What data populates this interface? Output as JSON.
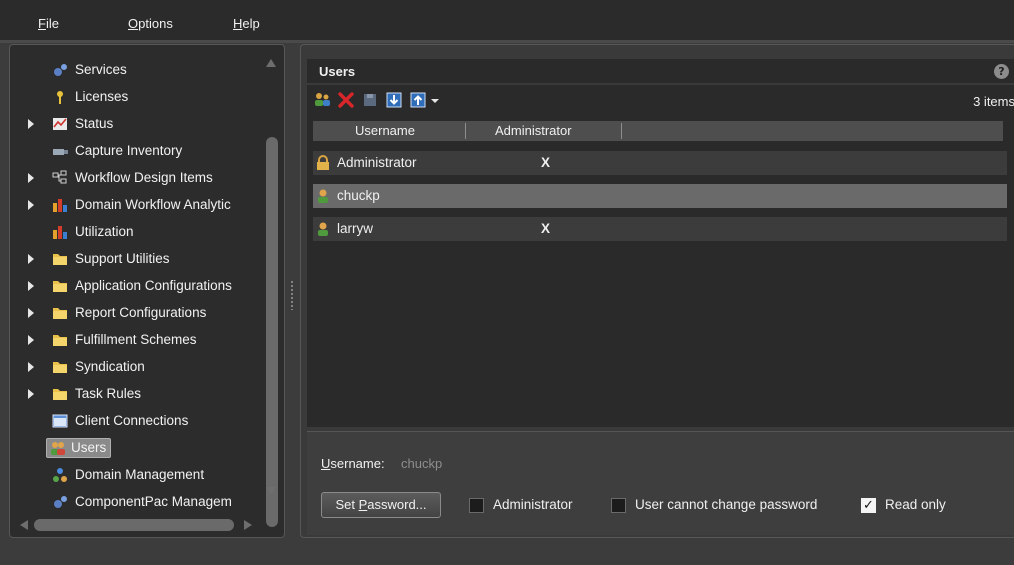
{
  "menu": [
    {
      "prefix": "",
      "accel": "F",
      "rest": "ile"
    },
    {
      "prefix": "",
      "accel": "O",
      "rest": "ptions"
    },
    {
      "prefix": "",
      "accel": "H",
      "rest": "elp"
    }
  ],
  "tree": [
    {
      "label": "Services",
      "icon": "services-icon",
      "expandable": false
    },
    {
      "label": "Licenses",
      "icon": "key-icon",
      "expandable": false
    },
    {
      "label": "Status",
      "icon": "status-chart-icon",
      "expandable": true
    },
    {
      "label": "Capture Inventory",
      "icon": "capture-inventory-icon",
      "expandable": false
    },
    {
      "label": "Workflow Design Items",
      "icon": "workflow-icon",
      "expandable": true
    },
    {
      "label": "Domain Workflow Analytic",
      "icon": "analytics-bar-icon",
      "expandable": true
    },
    {
      "label": "Utilization",
      "icon": "utilization-bar-icon",
      "expandable": false
    },
    {
      "label": "Support Utilities",
      "icon": "folder-icon",
      "expandable": true
    },
    {
      "label": "Application Configurations",
      "icon": "folder-icon",
      "expandable": true
    },
    {
      "label": "Report Configurations",
      "icon": "folder-icon",
      "expandable": true
    },
    {
      "label": "Fulfillment Schemes",
      "icon": "folder-icon",
      "expandable": true
    },
    {
      "label": "Syndication",
      "icon": "folder-icon",
      "expandable": true
    },
    {
      "label": "Task Rules",
      "icon": "folder-icon",
      "expandable": true
    },
    {
      "label": "Client Connections",
      "icon": "client-connections-icon",
      "expandable": false
    },
    {
      "label": "Users",
      "icon": "users-icon",
      "expandable": false,
      "selected": true
    },
    {
      "label": "Domain Management",
      "icon": "domain-management-icon",
      "expandable": false
    },
    {
      "label": "ComponentPac Managem",
      "icon": "componentpac-icon",
      "expandable": false
    }
  ],
  "panel": {
    "title": "Users",
    "help": "?",
    "item_count": "3 items"
  },
  "table": {
    "columns": [
      "Username",
      "Administrator"
    ],
    "rows": [
      {
        "username": "Administrator",
        "admin": "X",
        "icon": "lock-icon"
      },
      {
        "username": "chuckp",
        "admin": "",
        "icon": "user-icon",
        "selected": true
      },
      {
        "username": "larryw",
        "admin": "X",
        "icon": "user-icon"
      }
    ]
  },
  "detail": {
    "username_label_accel": "U",
    "username_label_rest": "sername:",
    "username_value": "chuckp",
    "set_password_pre": "Set ",
    "set_password_accel": "P",
    "set_password_rest": "assword...",
    "checkboxes": [
      {
        "label": "Administrator",
        "checked": false
      },
      {
        "label": "User cannot change password",
        "checked": false
      },
      {
        "label": "Read only",
        "checked": true,
        "mark": "✓"
      }
    ]
  }
}
